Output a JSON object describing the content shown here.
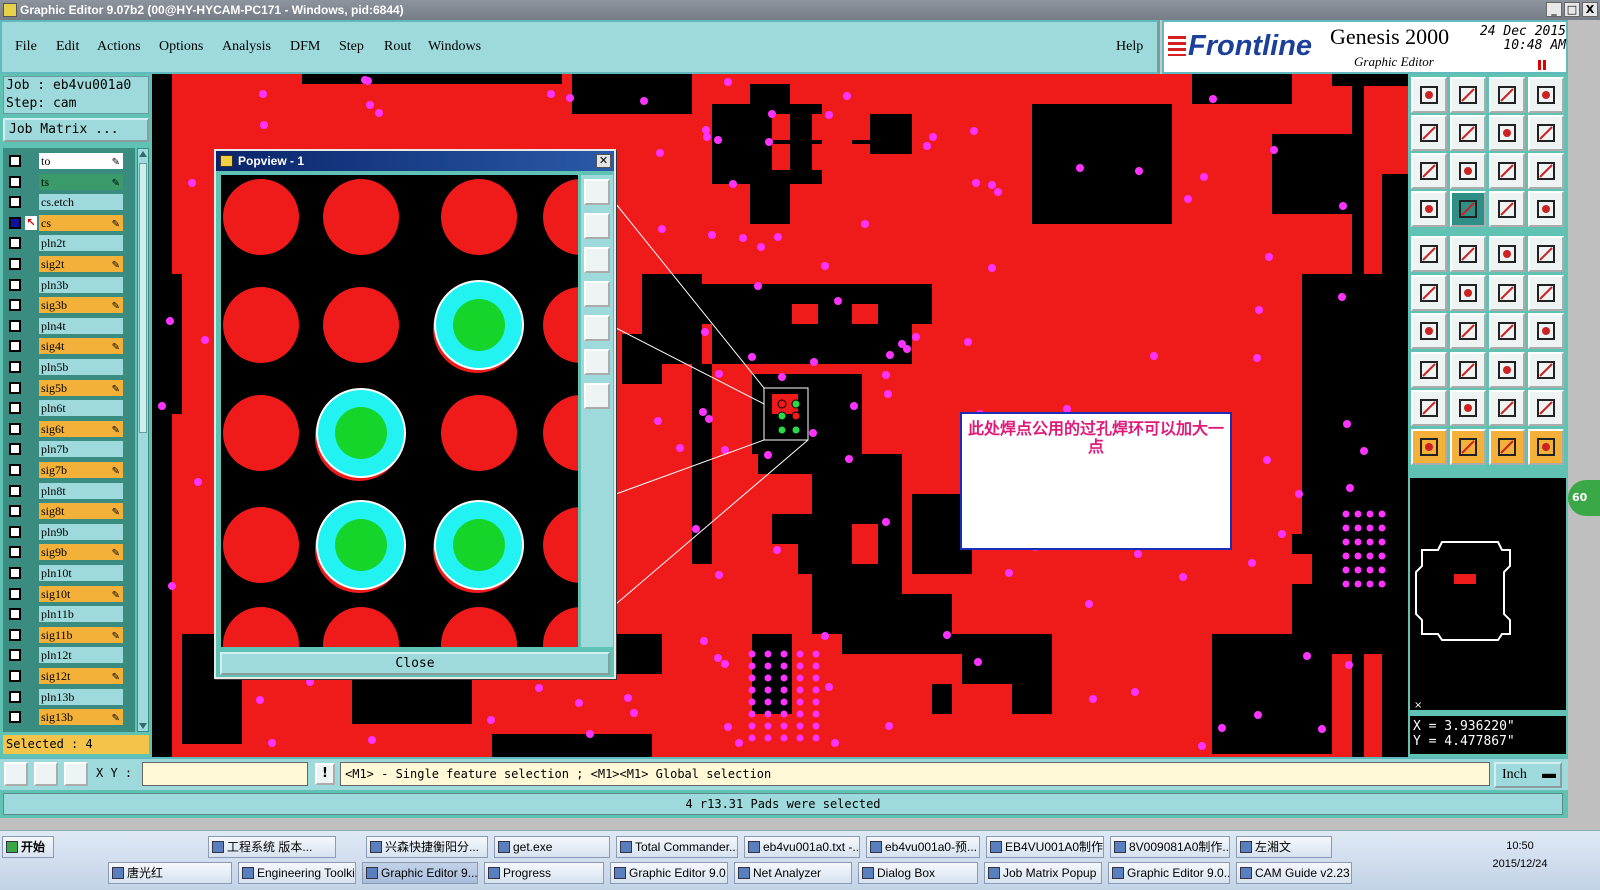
{
  "window": {
    "title": "Graphic Editor 9.07b2 (00@HY-HYCAM-PC171 - Windows, pid:6844)",
    "controls": [
      "_",
      "□",
      "X"
    ]
  },
  "menu": {
    "items": [
      "File",
      "Edit",
      "Actions",
      "Options",
      "Analysis",
      "DFM",
      "Step",
      "Rout",
      "Windows"
    ],
    "help": "Help"
  },
  "brand": {
    "logo": "Frontline",
    "product": "Genesis 2000",
    "subtitle": "Graphic Editor",
    "date": "24 Dec 2015",
    "time": "10:48 AM"
  },
  "job": {
    "job": "Job : eb4vu001a0",
    "step": "Step: cam",
    "matrix_button": "Job Matrix ..."
  },
  "layers": [
    {
      "name": "to",
      "color": "#ffffff",
      "editable": true
    },
    {
      "name": "ts",
      "color": "#3a9a6a",
      "editable": true
    },
    {
      "name": "cs.etch",
      "color": "#9ed9dc",
      "editable": false
    },
    {
      "name": "cs",
      "color": "#f3b13a",
      "editable": true,
      "work": true
    },
    {
      "name": "pln2t",
      "color": "#9ed9dc",
      "editable": false
    },
    {
      "name": "sig2t",
      "color": "#f3b13a",
      "editable": true
    },
    {
      "name": "pln3b",
      "color": "#9ed9dc",
      "editable": false
    },
    {
      "name": "sig3b",
      "color": "#f3b13a",
      "editable": true
    },
    {
      "name": "pln4t",
      "color": "#9ed9dc",
      "editable": false
    },
    {
      "name": "sig4t",
      "color": "#f3b13a",
      "editable": true
    },
    {
      "name": "pln5b",
      "color": "#9ed9dc",
      "editable": false
    },
    {
      "name": "sig5b",
      "color": "#f3b13a",
      "editable": true
    },
    {
      "name": "pln6t",
      "color": "#9ed9dc",
      "editable": false
    },
    {
      "name": "sig6t",
      "color": "#f3b13a",
      "editable": true
    },
    {
      "name": "pln7b",
      "color": "#9ed9dc",
      "editable": false
    },
    {
      "name": "sig7b",
      "color": "#f3b13a",
      "editable": true
    },
    {
      "name": "pln8t",
      "color": "#9ed9dc",
      "editable": false
    },
    {
      "name": "sig8t",
      "color": "#f3b13a",
      "editable": true
    },
    {
      "name": "pln9b",
      "color": "#9ed9dc",
      "editable": false
    },
    {
      "name": "sig9b",
      "color": "#f3b13a",
      "editable": true
    },
    {
      "name": "pln10t",
      "color": "#9ed9dc",
      "editable": false
    },
    {
      "name": "sig10t",
      "color": "#f3b13a",
      "editable": true
    },
    {
      "name": "pln11b",
      "color": "#9ed9dc",
      "editable": false
    },
    {
      "name": "sig11b",
      "color": "#f3b13a",
      "editable": true
    },
    {
      "name": "pln12t",
      "color": "#9ed9dc",
      "editable": false
    },
    {
      "name": "sig12t",
      "color": "#f3b13a",
      "editable": true
    },
    {
      "name": "pln13b",
      "color": "#9ed9dc",
      "editable": false
    },
    {
      "name": "sig13b",
      "color": "#f3b13a",
      "editable": true
    }
  ],
  "selected_text": "Selected : 4",
  "popview": {
    "title": "Popview - 1",
    "close_label": "Close"
  },
  "note": "此处焊点公用的过孔焊环可以加大一点",
  "coords": {
    "x": "X = 3.936220\"",
    "y": "Y = 4.477867\""
  },
  "status": {
    "xy_label": "X Y :",
    "xy_value": "",
    "hint": "<M1> - Single feature selection ; <M1><M1> Global selection",
    "units": "Inch"
  },
  "message": "4 r13.31 Pads were selected",
  "badge": "60",
  "taskbar": {
    "start": "开始",
    "row1": [
      "工程系统  版本...",
      "兴森快捷衡阳分...",
      "get.exe",
      "Total Commander...",
      "eb4vu001a0.txt -...",
      "eb4vu001a0-预...",
      "EB4VU001A0制作...",
      "8V009081A0制作...",
      "左湘文"
    ],
    "row2": [
      "唐光红",
      "Engineering Toolki...",
      "Graphic Editor 9....",
      "Progress",
      "Graphic Editor 9.0...",
      "Net Analyzer",
      "Dialog Box",
      "Job Matrix Popup",
      "Graphic Editor 9.0...",
      "CAM  Guide v2.23"
    ],
    "clock_time": "10:50",
    "clock_date": "2015/12/24"
  },
  "colors": {
    "board": "#ef1a1a",
    "trace": "#000000",
    "via": "#ff33ff",
    "panel": "#9ed9dc",
    "accent": "#5fc2b2"
  }
}
